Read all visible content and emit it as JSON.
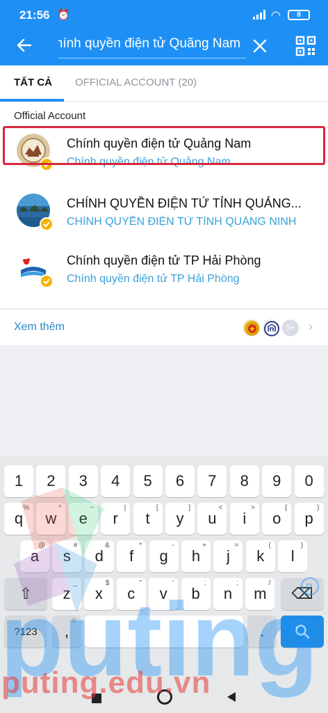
{
  "status": {
    "time": "21:56",
    "battery": "8"
  },
  "header": {
    "search_value": "Chính quyền điện tử Quãng Nam"
  },
  "tabs": [
    {
      "label": "TẤT CẢ"
    },
    {
      "label": "OFFICIAL ACCOUNT (20)"
    }
  ],
  "results": {
    "section_title": "Official Account",
    "items": [
      {
        "title": "Chính quyền điện tử Quảng Nam",
        "subtitle": "Chính quyền điện tử Quảng Nam",
        "avatar": "quang-nam-seal"
      },
      {
        "title": "CHÍNH QUYỀN ĐIỆN TỬ TỈNH QUẢNG...",
        "subtitle": "CHÍNH QUYỀN ĐIỆN TỬ TỈNH QUẢNG NINH",
        "avatar": "quang-ninh-bay"
      },
      {
        "title": "Chính quyền điện tử TP Hải Phòng",
        "subtitle": "Chính quyền điện tử TP Hải Phòng",
        "avatar": "hai-phong-logo"
      }
    ],
    "more_label": "Xem thêm",
    "more_count": "5+"
  },
  "keyboard": {
    "row_numbers": [
      "1",
      "2",
      "3",
      "4",
      "5",
      "6",
      "7",
      "8",
      "9",
      "0"
    ],
    "row1": [
      [
        "q",
        "%"
      ],
      [
        "w",
        "^"
      ],
      [
        "e",
        "~"
      ],
      [
        "r",
        "|"
      ],
      [
        "t",
        "["
      ],
      [
        "y",
        "]"
      ],
      [
        "u",
        "<"
      ],
      [
        "i",
        ">"
      ],
      [
        "o",
        "{"
      ],
      [
        "p",
        "}"
      ]
    ],
    "row2": [
      [
        "a",
        "@"
      ],
      [
        "s",
        "#"
      ],
      [
        "d",
        "&"
      ],
      [
        "f",
        "*"
      ],
      [
        "g",
        "-"
      ],
      [
        "h",
        "+"
      ],
      [
        "j",
        "="
      ],
      [
        "k",
        "("
      ],
      [
        "l",
        ")"
      ]
    ],
    "row3": [
      [
        "z",
        "_"
      ],
      [
        "x",
        "$"
      ],
      [
        "c",
        "\""
      ],
      [
        "v",
        "'"
      ],
      [
        "b",
        ":"
      ],
      [
        "n",
        ";"
      ],
      [
        "m",
        "/"
      ]
    ],
    "symbols_label": "?123",
    "comma": ",",
    "period": "."
  },
  "watermark": {
    "text": "puting.edu.vn",
    "big": "puting"
  },
  "colors": {
    "accent": "#1e90f5",
    "highlight": "#d7263d",
    "link": "#3aa0d8"
  }
}
